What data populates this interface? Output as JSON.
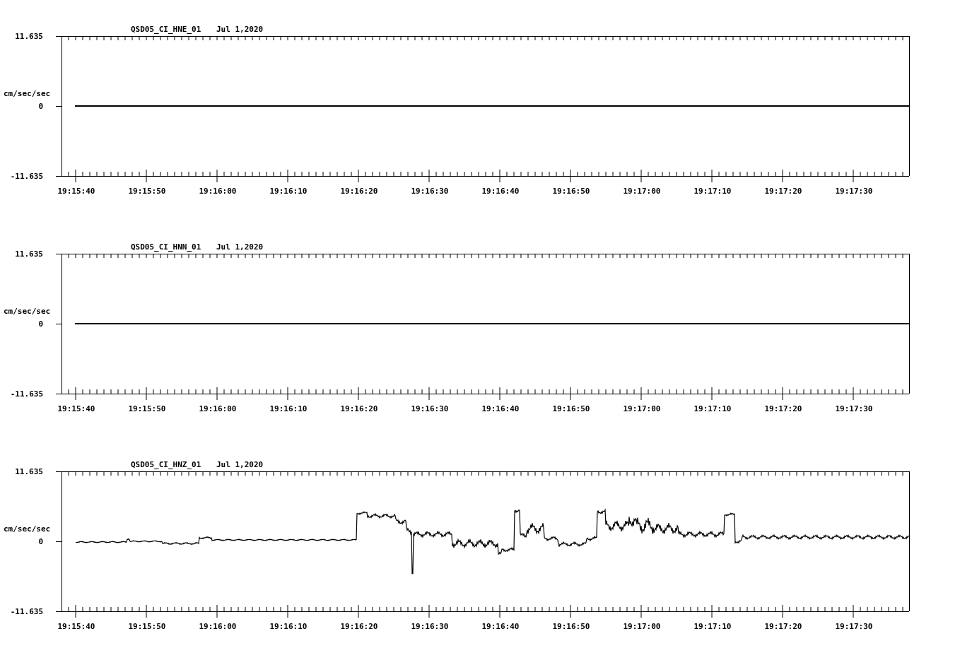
{
  "panels": [
    {
      "station": "QSD05_CI_HNE_01",
      "date": "Jul 1,2020",
      "y_unit": "cm/sec/sec",
      "y_ticks": [
        "11.635",
        "0",
        "-11.635"
      ],
      "x_ticks": [
        "19:15:40",
        "19:15:50",
        "19:16:00",
        "19:16:10",
        "19:16:20",
        "19:16:30",
        "19:16:40",
        "19:16:50",
        "19:17:00",
        "19:17:10",
        "19:17:20",
        "19:17:30"
      ],
      "kind": "flat"
    },
    {
      "station": "QSD05_CI_HNN_01",
      "date": "Jul 1,2020",
      "y_unit": "cm/sec/sec",
      "y_ticks": [
        "11.635",
        "0",
        "-11.635"
      ],
      "x_ticks": [
        "19:15:40",
        "19:15:50",
        "19:16:00",
        "19:16:10",
        "19:16:20",
        "19:16:30",
        "19:16:40",
        "19:16:50",
        "19:17:00",
        "19:17:10",
        "19:17:20",
        "19:17:30"
      ],
      "kind": "flat"
    },
    {
      "station": "QSD05_CI_HNZ_01",
      "date": "Jul 1,2020",
      "y_unit": "cm/sec/sec",
      "y_ticks": [
        "11.635",
        "0",
        "-11.635"
      ],
      "x_ticks": [
        "19:15:40",
        "19:15:50",
        "19:16:00",
        "19:16:10",
        "19:16:20",
        "19:16:30",
        "19:16:40",
        "19:16:50",
        "19:17:00",
        "19:17:10",
        "19:17:20",
        "19:17:30"
      ],
      "kind": "waveform"
    }
  ]
}
